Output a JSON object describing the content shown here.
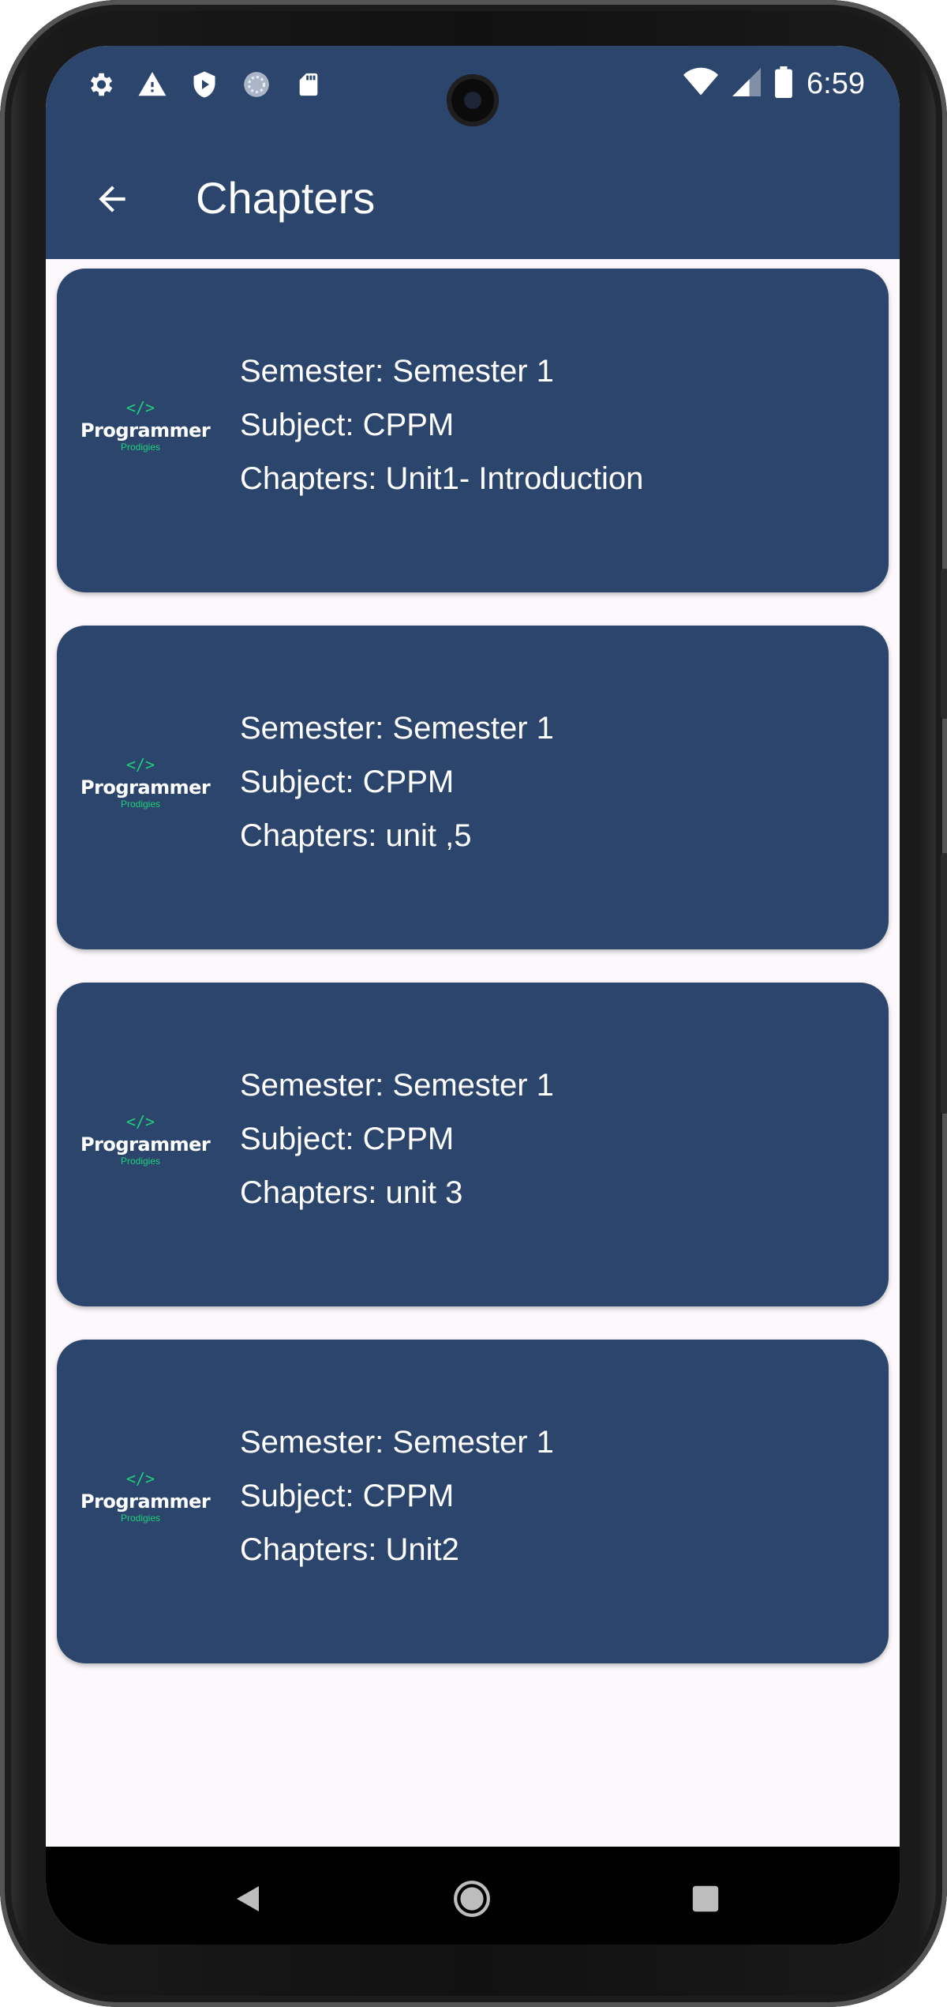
{
  "status_bar": {
    "time": "6:59",
    "left_icons": [
      "gear-icon",
      "warning-icon",
      "shield-play-icon",
      "circle-loading-icon",
      "sd-card-icon"
    ],
    "right_icons": [
      "wifi-icon",
      "cell-signal-icon",
      "battery-icon"
    ]
  },
  "app_bar": {
    "title": "Chapters",
    "back_icon": "arrow-left-icon",
    "color": "#2c456c"
  },
  "logo": {
    "code_glyph": "</>",
    "main": "Programmer",
    "sub": "Prodigies",
    "accent": "#1fcf7a"
  },
  "cards": [
    {
      "semester": "Semester: Semester 1",
      "subject": "Subject: CPPM",
      "chapters": "Chapters: Unit1- Introduction"
    },
    {
      "semester": "Semester: Semester 1",
      "subject": "Subject: CPPM",
      "chapters": "Chapters: unit ,5"
    },
    {
      "semester": "Semester: Semester 1",
      "subject": "Subject: CPPM",
      "chapters": "Chapters: unit 3"
    },
    {
      "semester": "Semester: Semester 1",
      "subject": "Subject: CPPM",
      "chapters": "Chapters: Unit2"
    }
  ],
  "nav_bar": {
    "buttons": [
      "back-triangle-icon",
      "home-circle-icon",
      "recents-square-icon"
    ]
  }
}
